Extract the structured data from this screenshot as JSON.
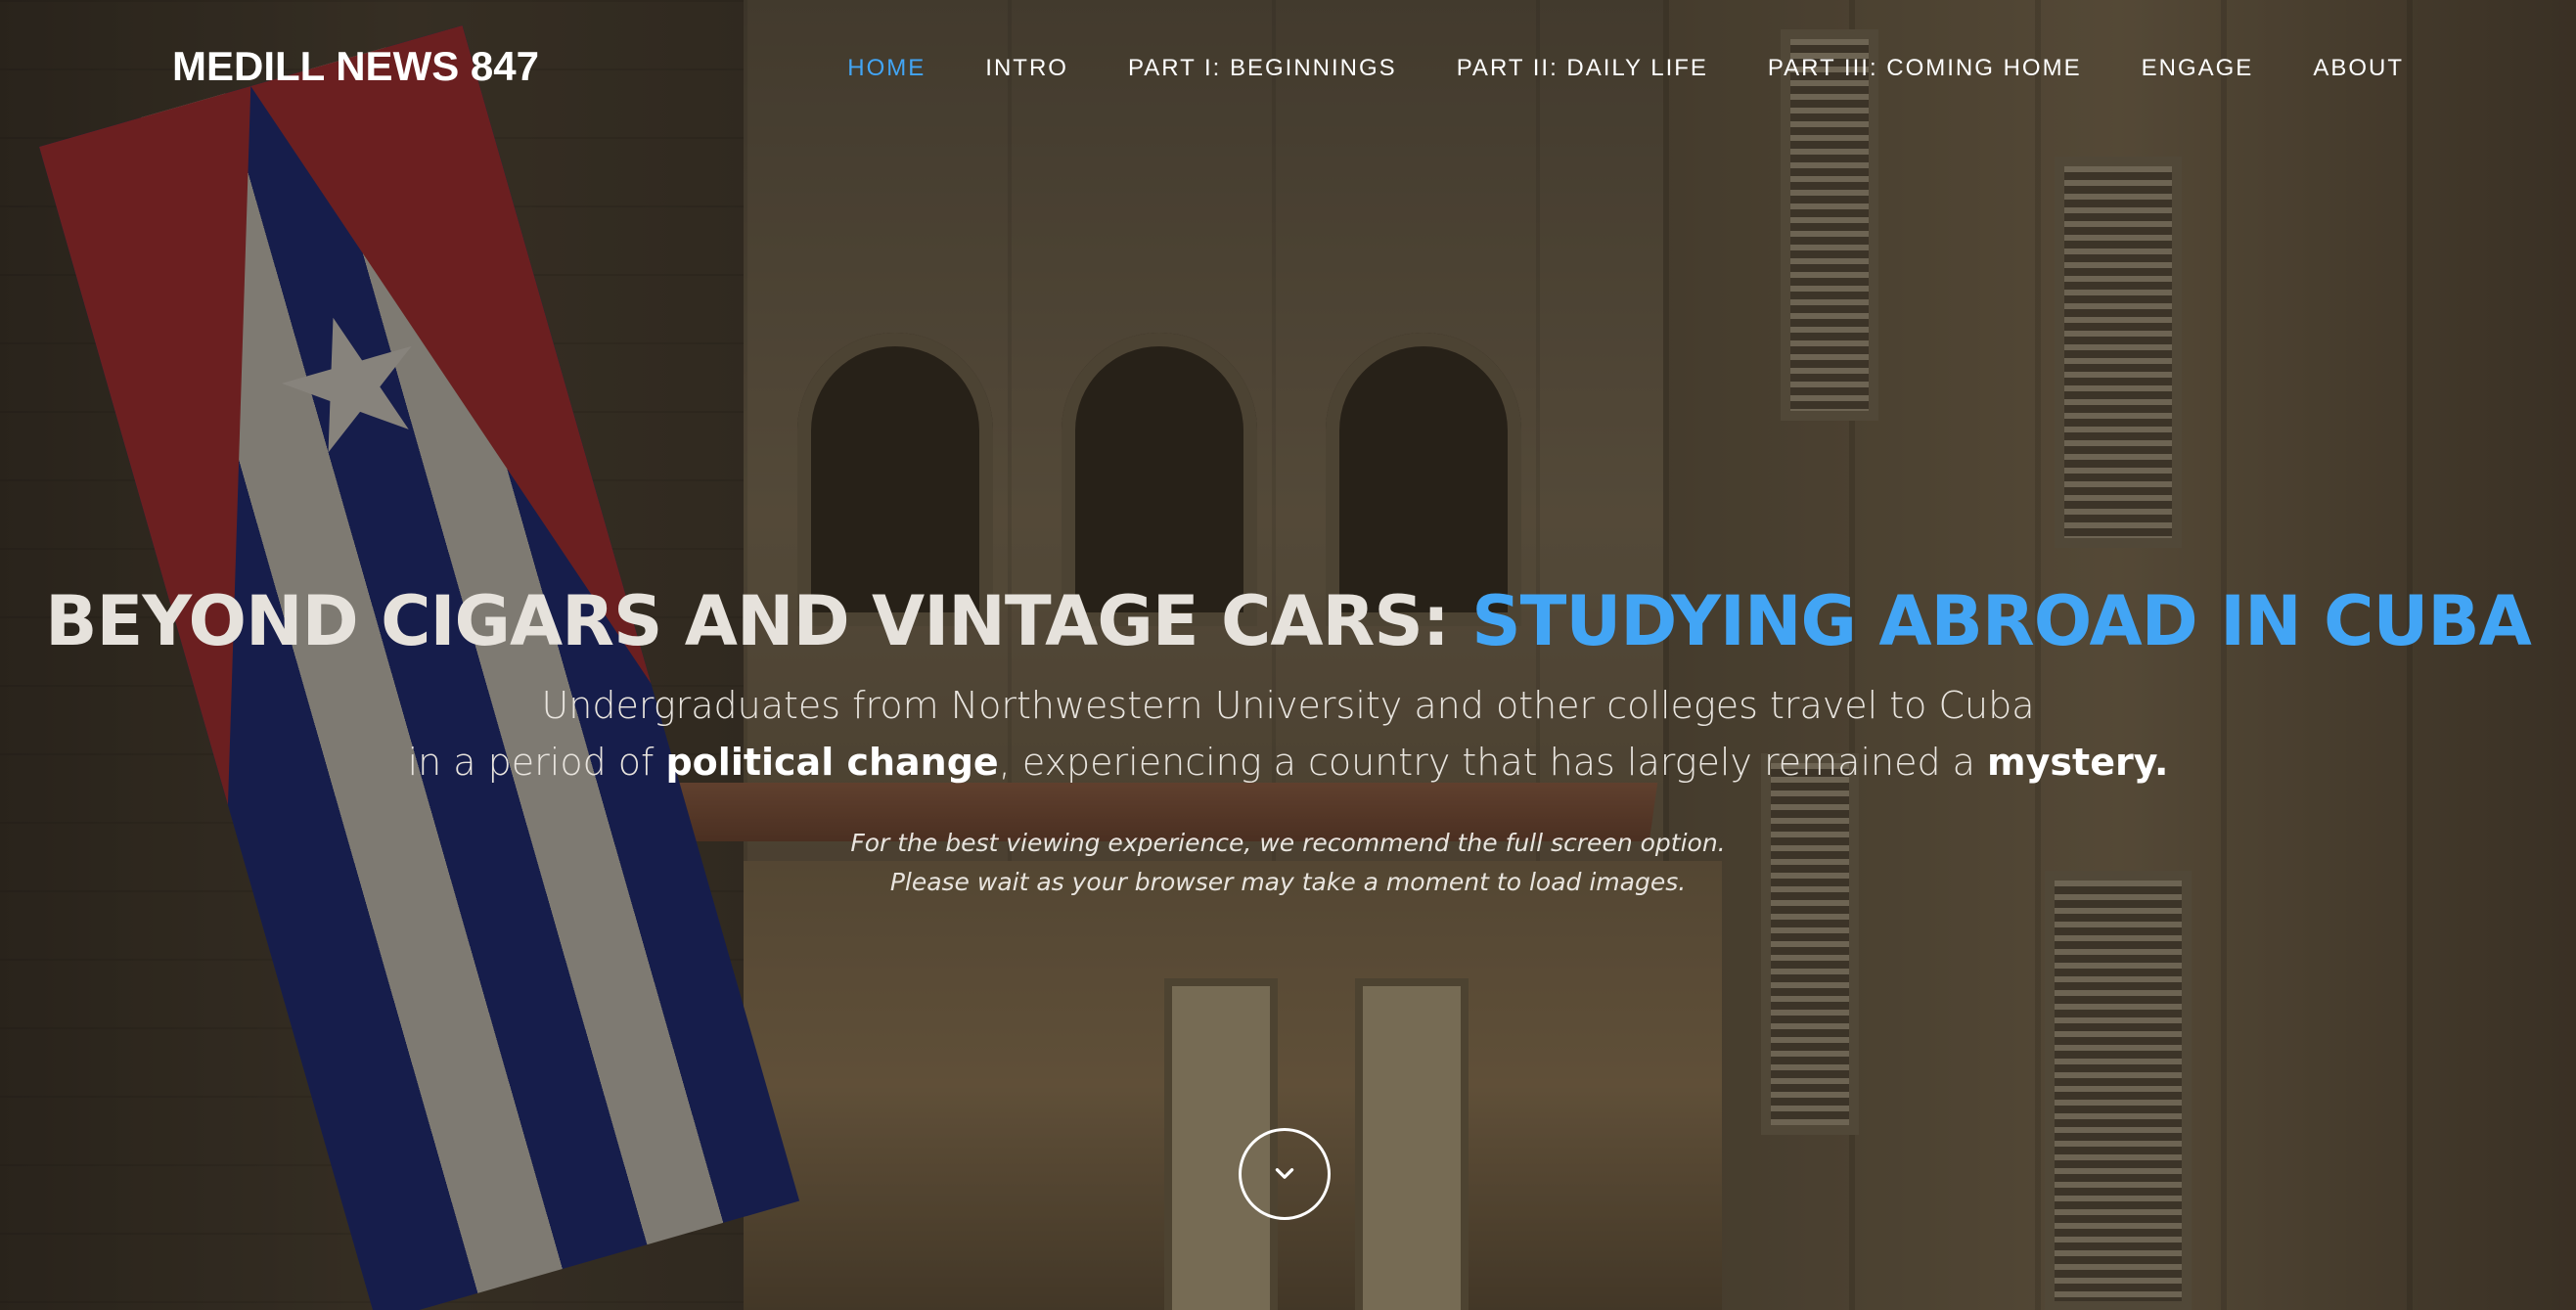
{
  "site": {
    "brand": "MEDILL NEWS 847"
  },
  "nav": {
    "items": [
      {
        "label": "HOME",
        "active": true
      },
      {
        "label": "INTRO",
        "active": false
      },
      {
        "label": "PART I: BEGINNINGS",
        "active": false
      },
      {
        "label": "PART II: DAILY LIFE",
        "active": false
      },
      {
        "label": "PART III: COMING HOME",
        "active": false
      },
      {
        "label": "ENGAGE",
        "active": false
      },
      {
        "label": "ABOUT",
        "active": false
      }
    ]
  },
  "hero": {
    "title_plain": "BEYOND CIGARS AND VINTAGE CARS: ",
    "title_accent": "STUDYING ABROAD IN CUBA",
    "sub_line1": "Undergraduates from Northwestern University and other colleges travel to Cuba",
    "sub_line2_a": "in a period of ",
    "sub_line2_b": "political change",
    "sub_line2_c": ", experiencing a country that has largely remained a ",
    "sub_line2_d": "mystery.",
    "note_line1": "For the best viewing experience, we recommend the full screen option.",
    "note_line2": "Please wait as your browser may take a moment to load images."
  },
  "scroll_button": {
    "icon": "chevron-down-icon"
  },
  "colors": {
    "accent": "#42a5f5",
    "text": "#ffffff"
  }
}
